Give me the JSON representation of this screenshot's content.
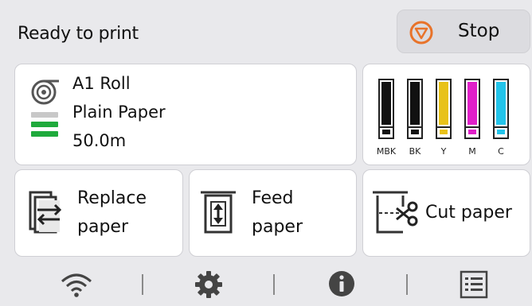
{
  "status": {
    "text": "Ready to print"
  },
  "stop_button": {
    "label": "Stop",
    "icon": "stop-icon",
    "icon_color": "#e8732a"
  },
  "paper": {
    "icon": "roll-paper-icon",
    "size": "A1 Roll",
    "type": "Plain Paper",
    "remaining": "50.0m",
    "level_bars_filled": 2,
    "level_bars_total": 3,
    "level_color": "#1faa3c"
  },
  "ink": [
    {
      "label": "MBK",
      "color": "#111111"
    },
    {
      "label": "BK",
      "color": "#111111"
    },
    {
      "label": "Y",
      "color": "#e8c21a"
    },
    {
      "label": "M",
      "color": "#e020c8"
    },
    {
      "label": "C",
      "color": "#22c4ea"
    }
  ],
  "actions": {
    "replace": {
      "line1": "Replace",
      "line2": "paper",
      "icon": "replace-paper-icon"
    },
    "feed": {
      "line1": "Feed",
      "line2": "paper",
      "icon": "feed-paper-icon"
    },
    "cut": {
      "label": "Cut paper",
      "icon": "cut-paper-icon"
    }
  },
  "bottom_bar": [
    "wifi-icon",
    "settings-gear-icon",
    "info-icon",
    "job-list-icon"
  ]
}
